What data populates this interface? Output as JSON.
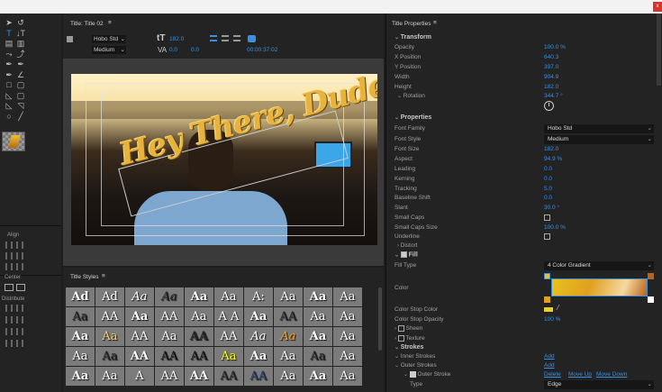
{
  "window": {
    "close_icon": "x"
  },
  "tools": {
    "icons": [
      "selection-tool",
      "rotation-tool",
      "type-tool",
      "vertical-type-tool",
      "area-type-tool",
      "vertical-area-type-tool",
      "path-type-tool",
      "vertical-path-type-tool",
      "pen-tool",
      "delete-anchor-tool",
      "add-anchor-tool",
      "convert-anchor-tool",
      "rectangle-tool",
      "rounded-rectangle-tool",
      "clipped-corner-tool",
      "rounded-corner-tool",
      "wedge-tool",
      "arc-tool",
      "ellipse-tool",
      "line-tool"
    ]
  },
  "actions": {
    "align_label": "Align",
    "center_label": "Center",
    "distribute_label": "Distribute"
  },
  "title_panel": {
    "title": "Title: Title 02",
    "menu_icon": "≡",
    "font_family": "Hobo Std",
    "font_style": "Medium",
    "font_size": "182.0",
    "kerning": "0.0",
    "leading": "0.0",
    "timecode": "00:00:37:02"
  },
  "canvas": {
    "headline": "Hey There, Dude!"
  },
  "styles_panel": {
    "title": "Title Styles",
    "cells": [
      "Ad",
      "Ad",
      "Aa",
      "Aa",
      "Aa",
      "Aa",
      "A:",
      "Aa",
      "Aa",
      "Aa",
      "Aa",
      "AA",
      "Aa",
      "AA",
      "Aa",
      "A A",
      "Aa",
      "AA",
      "Aa",
      "Aa",
      "Aa",
      "Aa",
      "AA",
      "Aa",
      "AA",
      "AA",
      "Aa",
      "Aa",
      "Aa",
      "Aa",
      "Aa",
      "Aa",
      "AA",
      "AA",
      "AA",
      "Aa",
      "Aa",
      "Aa",
      "Aa",
      "Aa",
      "Aa",
      "Aa",
      "A",
      "AA",
      "AA",
      "AA",
      "AA",
      "Aa",
      "Aa",
      "Aa"
    ]
  },
  "properties": {
    "title": "Title Properties",
    "transform": {
      "label": "Transform",
      "opacity_label": "Opacity",
      "opacity": "100.0 %",
      "x_label": "X Position",
      "x": "640.3",
      "y_label": "Y Position",
      "y": "397.0",
      "width_label": "Width",
      "width": "904.9",
      "height_label": "Height",
      "height": "182.0",
      "rotation_label": "Rotation",
      "rotation": "344.7 °"
    },
    "props": {
      "label": "Properties",
      "font_family_label": "Font Family",
      "font_family": "Hobo Std",
      "font_style_label": "Font Style",
      "font_style": "Medium",
      "font_size_label": "Font Size",
      "font_size": "182.0",
      "aspect_label": "Aspect",
      "aspect": "94.9 %",
      "leading_label": "Leading",
      "leading": "0.0",
      "kerning_label": "Kerning",
      "kerning": "0.0",
      "tracking_label": "Tracking",
      "tracking": "5.0",
      "baseline_label": "Baseline Shift",
      "baseline": "0.0",
      "slant_label": "Slant",
      "slant": "30.0 °",
      "small_caps_label": "Small Caps",
      "small_caps_size_label": "Small Caps Size",
      "small_caps_size": "100.0 %",
      "underline_label": "Underline",
      "distort_label": "Distort"
    },
    "fill": {
      "label": "Fill",
      "checked": true,
      "fill_type_label": "Fill Type",
      "fill_type": "4 Color Gradient",
      "color_label": "Color",
      "stop_color_label": "Color Stop Color",
      "stop_opacity_label": "Color Stop Opacity",
      "stop_opacity": "100 %",
      "sheen_label": "Sheen",
      "texture_label": "Texture",
      "gradient_colors": [
        "#e8c21e",
        "#b8621a",
        "#e0a020",
        "#ffffff"
      ]
    },
    "strokes": {
      "label": "Strokes",
      "inner_label": "Inner Strokes",
      "inner_add": "Add",
      "outer_label": "Outer Strokes",
      "outer_add": "Add",
      "outer_stroke_label": "Outer Stroke",
      "delete": "Delete",
      "move_up": "Move Up",
      "move_down": "Move Down",
      "type_label": "Type",
      "type": "Edge"
    }
  }
}
